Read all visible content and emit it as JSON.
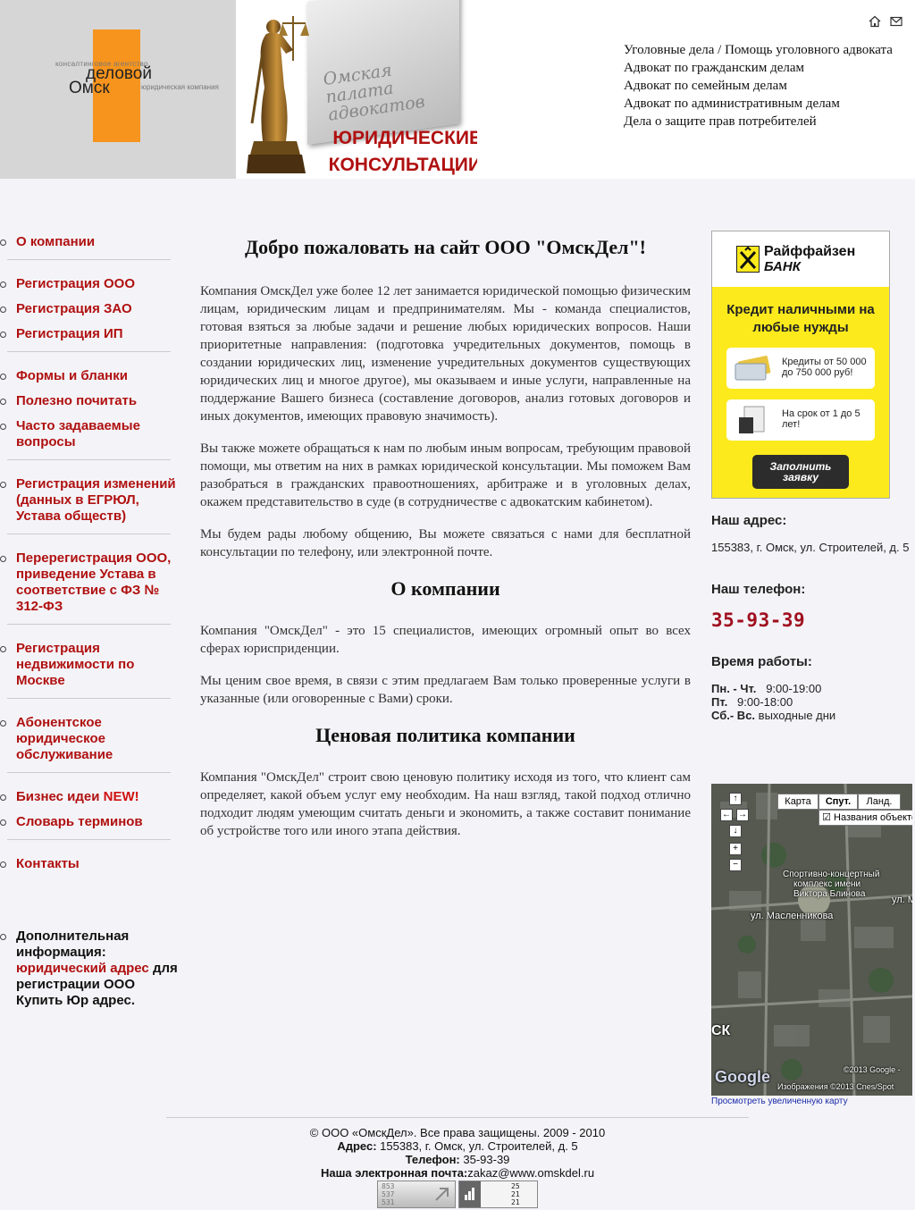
{
  "header": {
    "logo": {
      "tagline_top": "консалтинговое агентство",
      "word1": "деловой",
      "word2": "Омск",
      "tagline_bottom": "юридическая компания"
    },
    "banner": {
      "chamber": "Омская палата адвокатов",
      "title_line1": "ЮРИДИЧЕСКИЕ",
      "title_line2": "КОНСУЛЬТАЦИИ"
    },
    "links": [
      "Уголовные дела / Помощь уголовного адвоката",
      "Адвокат по гражданским делам",
      "Адвокат по семейным делам",
      "Адвокат по административным делам",
      "Дела о защите прав потребителей"
    ],
    "icons": [
      "home-icon",
      "mail-icon"
    ]
  },
  "sidebar": {
    "items": [
      "О компании",
      "Регистрация ООО",
      "Регистрация ЗАО",
      "Регистрация ИП",
      "Формы и бланки",
      "Полезно почитать",
      "Часто задаваемые вопросы",
      "Регистрация изменений (данных в ЕГРЮЛ, Устава обществ)",
      "Перерегистрация ООО, приведение Устава в соответствие с ФЗ № 312-ФЗ",
      "Регистрация недвижимости по Москве",
      "Абонентское юридическое обслуживание",
      "Бизнес идеи",
      "Словарь терминов",
      "Контакты"
    ],
    "new_badge": "NEW!",
    "extra": {
      "label": "Дополнительная информация:",
      "link": "юридический адрес",
      "suffix": "для регистрации ООО",
      "buy": "Купить Юр адрес."
    }
  },
  "main": {
    "welcome_title": "Добро пожаловать на сайт ООО \"ОмскДел\"!",
    "intro_p1": "Компания ОмскДел уже более 12 лет занимается юридической помощью физическим лицам, юридическим лицам и предпринимателям. Мы - команда специалистов, готовая взяться за любые задачи и решение любых юридических вопросов. Наши приоритетные направления: (подготовка учредительных документов, помощь в создании юридических лиц, изменение учредительных документов существующих юридических лиц и многое другое), мы оказываем и иные услуги, направленные на поддержание Вашего бизнеса (составление договоров, анализ готовых договоров и иных документов, имеющих правовую значимость).",
    "intro_p2": "Вы также можете обращаться к нам по любым иным вопросам, требующим правовой помощи, мы ответим на них в рамках юридической консультации. Мы поможем Вам разобраться в гражданских правоотношениях, арбитраже и в уголовных делах, окажем представительство в суде (в сотрудничестве с адвокатским кабинетом).",
    "intro_p3": "Мы будем рады любому общению, Вы можете связаться с нами для бесплатной консультации по телефону, или электронной почте.",
    "about_title": "О компании",
    "about_p1": "Компания \"ОмскДел\" - это 15 специалистов, имеющих огромный опыт во всех сферах юрисприденции.",
    "about_p2": "Мы ценим свое время, в связи с этим предлагаем Вам только проверенные услуги в указанные (или оговоренные с Вами) сроки.",
    "price_title": "Ценовая политика компании",
    "price_p1": "Компания \"ОмскДел\" строит свою ценовую политику исходя из того, что клиент сам определяет, какой объем услуг ему необходим. На наш взгляд, такой подход отлично подходит людям умеющим считать деньги и экономить, а также составит понимание об устройстве того или иного этапа действия."
  },
  "ad": {
    "brand1": "Райффайзен",
    "brand2": "БАНК",
    "headline": "Кредит наличными на любые нужды",
    "card1": "Кредиты от 50 000 до 750 000 руб!",
    "card2": "На срок от 1 до 5 лет!",
    "button": "Заполнить заявку",
    "colors": {
      "yellow": "#fcea1c",
      "button": "#2c2c2c"
    }
  },
  "contact": {
    "address_title": "Наш адрес:",
    "address": "155383, г. Омск, ул. Строителей, д. 5",
    "phone_title": "Наш телефон:",
    "phone": "35-93-39",
    "hours_title": "Время работы:",
    "hours": [
      {
        "day": "Пн. - Чт.",
        "time": "9:00-19:00"
      },
      {
        "day": "Пт.",
        "time": "9:00-18:00"
      },
      {
        "day": "Сб.- Вс.",
        "time": "выходные дни"
      }
    ]
  },
  "map": {
    "type_buttons": [
      "Карта",
      "Спут.",
      "Ланд."
    ],
    "labels_checkbox": "Названия объектов",
    "place_label_1": "Спортивно-концертный",
    "place_label_2": "комплекс имени",
    "place_label_3": "Виктора Блинова",
    "street_label": "ул. Масленникова",
    "street_label_2": "ул. М",
    "city_label": "СК",
    "google": "Google",
    "copyright": "©2013 Google -",
    "imagery": "Изображения ©2013 Cnes/Spot",
    "larger_link": "Просмотреть увеличенную карту"
  },
  "footer": {
    "copyright": "© ООО «ОмскДел». Все права защищены. 2009 - 2010",
    "address_label": "Адрес:",
    "address": "155383, г. Омск, ул. Строителей, д. 5",
    "phone_label": "Телефон:",
    "phone": "35-93-39",
    "email_label": "Наша электронная почта:",
    "email": "zakaz@www.omskdel.ru",
    "counter1": [
      "853",
      "537",
      "531"
    ],
    "counter2": [
      "25",
      "21",
      "21"
    ]
  },
  "colors": {
    "accent": "#b01010",
    "logo_orange": "#f7941d",
    "phone": "#a01020"
  }
}
